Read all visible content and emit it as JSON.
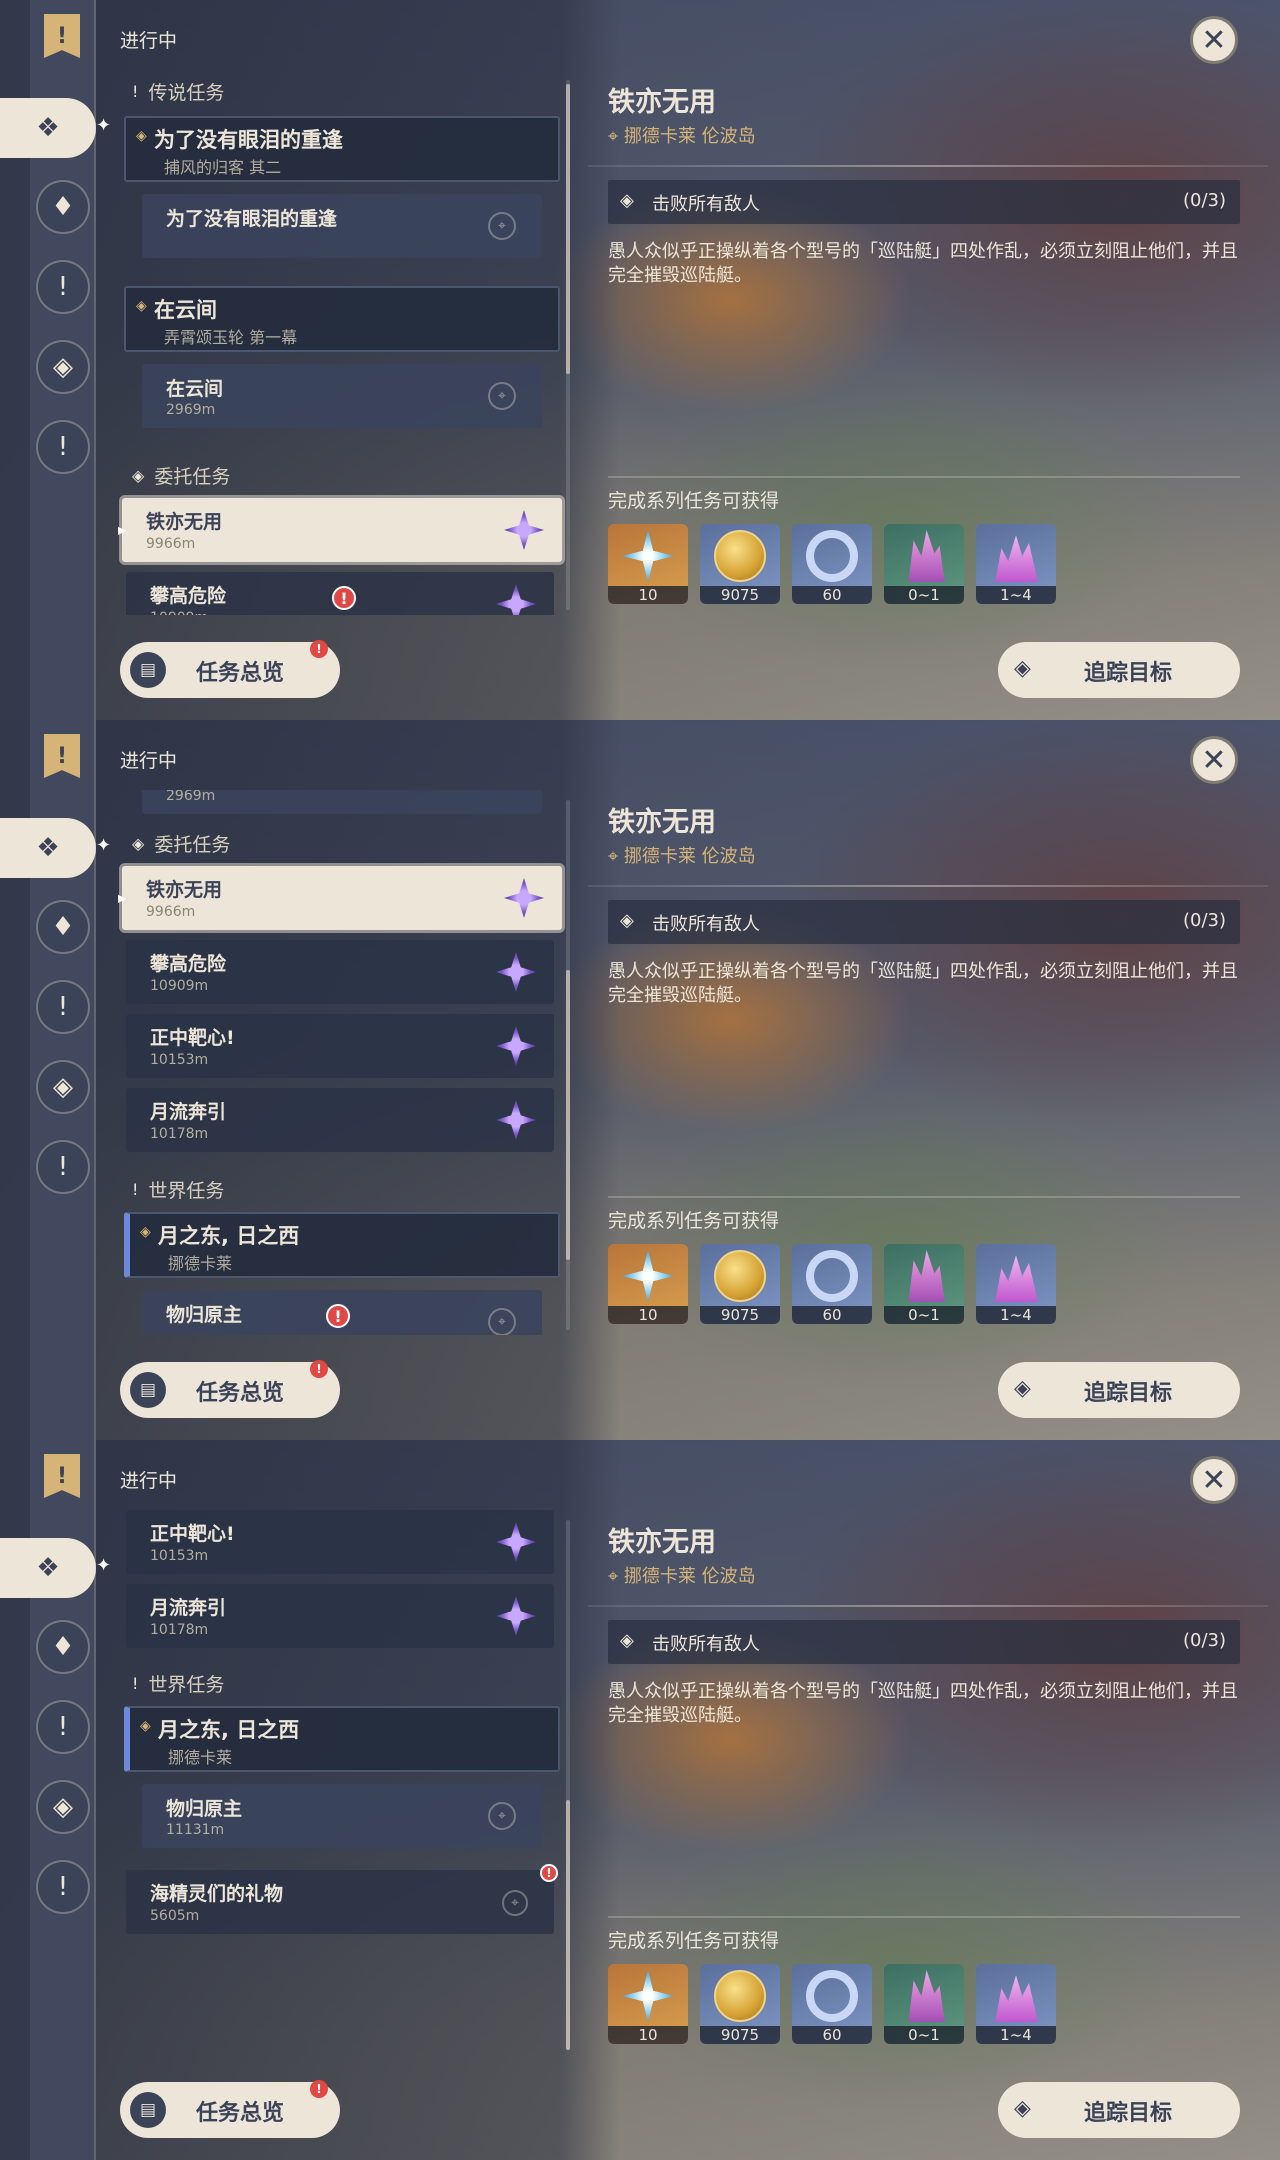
{
  "header": {
    "in_progress": "进行中"
  },
  "sections": {
    "legend": "传说任务",
    "commission": "委托任务",
    "world": "世界任务"
  },
  "legend_quests": [
    {
      "title": "为了没有眼泪的重逢",
      "chapter": "捕风的归客 其二",
      "step": "为了没有眼泪的重逢"
    },
    {
      "title": "在云间",
      "chapter": "弄霄颂玉轮 第一幕",
      "step": "在云间",
      "step_distance": "2969m"
    }
  ],
  "commissions": [
    {
      "title": "铁亦无用",
      "distance": "9966m"
    },
    {
      "title": "攀高危险",
      "distance": "10909m"
    },
    {
      "title": "正中靶心!",
      "distance": "10153m"
    },
    {
      "title": "月流奔引",
      "distance": "10178m"
    }
  ],
  "world_quests": [
    {
      "title": "月之东, 日之西",
      "region": "挪德卡莱",
      "step": "物归原主",
      "step_distance": "11131m"
    },
    {
      "title": "海精灵们的礼物",
      "distance": "5605m"
    }
  ],
  "detail": {
    "title": "铁亦无用",
    "location": "挪德卡莱 伦波岛",
    "objective": "击败所有敌人",
    "objective_count": "(0/3)",
    "description": "愚人众似乎正操纵着各个型号的「巡陆艇」四处作乱，必须立刻阻止他们，并且完全摧毁巡陆艇。",
    "rewards_title": "完成系列任务可获得",
    "rewards": [
      {
        "icon": "primogem-icon",
        "qty": "10"
      },
      {
        "icon": "mora-icon",
        "qty": "9075"
      },
      {
        "icon": "adventure-exp-icon",
        "qty": "60"
      },
      {
        "icon": "crystal-fragment-icon",
        "qty": "0~1"
      },
      {
        "icon": "crystal-cluster-icon",
        "qty": "1~4"
      }
    ]
  },
  "buttons": {
    "overview": "任务总览",
    "track": "追踪目标",
    "close": "✕"
  },
  "colors": {
    "accent": "#d6b478",
    "panel_light": "#ece5d8",
    "panel_dark": "#3b4358",
    "alert": "#e04846",
    "commission_badge": "#7d57c9"
  }
}
